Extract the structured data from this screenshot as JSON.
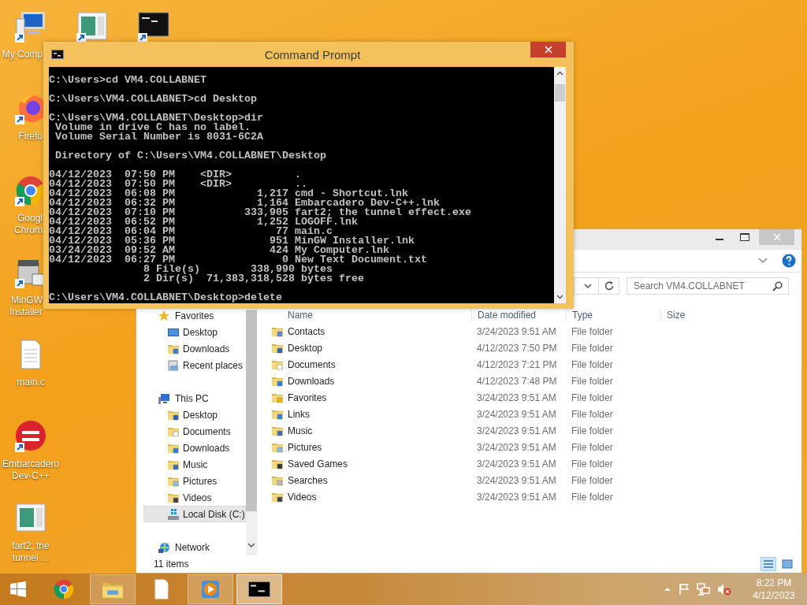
{
  "desktop": {
    "top_row": [
      {
        "kind": "computer",
        "shortcut": true,
        "lines": [
          "My Comp"
        ]
      },
      {
        "kind": "app-window",
        "shortcut": true
      },
      {
        "kind": "console",
        "shortcut": true
      }
    ],
    "column": [
      {
        "kind": "firefox",
        "shortcut": true,
        "lines": [
          "Firefo"
        ]
      },
      {
        "kind": "chrome",
        "shortcut": true,
        "lines": [
          "Googl",
          "Chrom"
        ]
      },
      {
        "kind": "installer",
        "shortcut": true,
        "lines": [
          "MinGW",
          "Installer"
        ]
      },
      {
        "kind": "text-file",
        "shortcut": false,
        "lines": [
          "main.c"
        ]
      },
      {
        "kind": "devcpp",
        "shortcut": true,
        "lines": [
          "Embarcadero",
          "Dev-C++"
        ]
      },
      {
        "kind": "app-window",
        "shortcut": false,
        "lines": [
          "fart2; the",
          "tunnel ..."
        ]
      }
    ]
  },
  "cmd": {
    "title": "Command Prompt",
    "blocks": [
      [
        "C:\\Users>cd VM4.COLLABNET"
      ],
      [
        "C:\\Users\\VM4.COLLABNET>cd Desktop"
      ],
      [
        "C:\\Users\\VM4.COLLABNET\\Desktop>dir",
        " Volume in drive C has no label.",
        " Volume Serial Number is 8031-6C2A"
      ],
      [
        " Directory of C:\\Users\\VM4.COLLABNET\\Desktop"
      ],
      [
        "04/12/2023  07:50 PM    <DIR>          .",
        "04/12/2023  07:50 PM    <DIR>          ..",
        "04/12/2023  06:08 PM             1,217 cmd - Shortcut.lnk",
        "04/12/2023  06:32 PM             1,164 Embarcadero Dev-C++.lnk",
        "04/12/2023  07:10 PM           333,905 fart2; the tunnel effect.exe",
        "04/12/2023  06:52 PM             1,252 LOGOFF.lnk",
        "04/12/2023  06:04 PM                77 main.c",
        "04/12/2023  05:36 PM               951 MinGW Installer.lnk",
        "03/24/2023  09:52 AM               424 My Computer.lnk",
        "04/12/2023  06:27 PM                 0 New Text Document.txt",
        "               8 File(s)        338,990 bytes",
        "               2 Dir(s)  71,383,318,528 bytes free"
      ],
      [
        "C:\\Users\\VM4.COLLABNET\\Desktop>delete"
      ]
    ]
  },
  "explorer": {
    "search": {
      "placeholder": "Search VM4.COLLABNET"
    },
    "columns": [
      "Name",
      "Date modified",
      "Type",
      "Size"
    ],
    "nav": [
      {
        "label": "Favorites",
        "kind": "favorites",
        "selected": false,
        "children": [
          {
            "label": "Desktop",
            "kind": "screen",
            "selected": false
          },
          {
            "label": "Downloads",
            "kind": "downloads",
            "selected": false
          },
          {
            "label": "Recent places",
            "kind": "recent",
            "selected": false
          }
        ]
      },
      {
        "label": "This PC",
        "kind": "pc",
        "selected": false,
        "children": [
          {
            "label": "Desktop",
            "kind": "desktop",
            "selected": false
          },
          {
            "label": "Documents",
            "kind": "documents",
            "selected": false
          },
          {
            "label": "Downloads",
            "kind": "downloads",
            "selected": false
          },
          {
            "label": "Music",
            "kind": "music",
            "selected": false
          },
          {
            "label": "Pictures",
            "kind": "pictures",
            "selected": false
          },
          {
            "label": "Videos",
            "kind": "videos",
            "selected": false
          },
          {
            "label": "Local Disk (C:)",
            "kind": "disk",
            "selected": true
          }
        ]
      },
      {
        "label": "Network",
        "kind": "network",
        "selected": false
      }
    ],
    "rows": [
      {
        "name": "Contacts",
        "kind": "contacts",
        "date": "3/24/2023 9:51 AM",
        "type": "File folder"
      },
      {
        "name": "Desktop",
        "kind": "desktop",
        "date": "4/12/2023 7:50 PM",
        "type": "File folder"
      },
      {
        "name": "Documents",
        "kind": "documents",
        "date": "4/12/2023 7:21 PM",
        "type": "File folder"
      },
      {
        "name": "Downloads",
        "kind": "downloads",
        "date": "4/12/2023 7:48 PM",
        "type": "File folder"
      },
      {
        "name": "Favorites",
        "kind": "favorites",
        "date": "3/24/2023 9:51 AM",
        "type": "File folder"
      },
      {
        "name": "Links",
        "kind": "links",
        "date": "3/24/2023 9:51 AM",
        "type": "File folder"
      },
      {
        "name": "Music",
        "kind": "music",
        "date": "3/24/2023 9:51 AM",
        "type": "File folder"
      },
      {
        "name": "Pictures",
        "kind": "pictures",
        "date": "3/24/2023 9:51 AM",
        "type": "File folder"
      },
      {
        "name": "Saved Games",
        "kind": "games",
        "date": "3/24/2023 9:51 AM",
        "type": "File folder"
      },
      {
        "name": "Searches",
        "kind": "searches",
        "date": "3/24/2023 9:51 AM",
        "type": "File folder"
      },
      {
        "name": "Videos",
        "kind": "videos",
        "date": "3/24/2023 9:51 AM",
        "type": "File folder"
      }
    ],
    "status": "11 items",
    "views": [
      {
        "kind": "details",
        "selected": true
      },
      {
        "kind": "tiles",
        "selected": false
      }
    ]
  },
  "taskbar": {
    "items": [
      {
        "kind": "chrome",
        "running": false,
        "active": false
      },
      {
        "kind": "explorer",
        "running": true,
        "active": false
      },
      {
        "kind": "file",
        "running": false,
        "active": false
      },
      {
        "kind": "media",
        "running": true,
        "active": false
      },
      {
        "kind": "console",
        "running": true,
        "active": true
      }
    ],
    "clock": {
      "time": "8:22 PM",
      "date": "4/12/2023"
    }
  }
}
